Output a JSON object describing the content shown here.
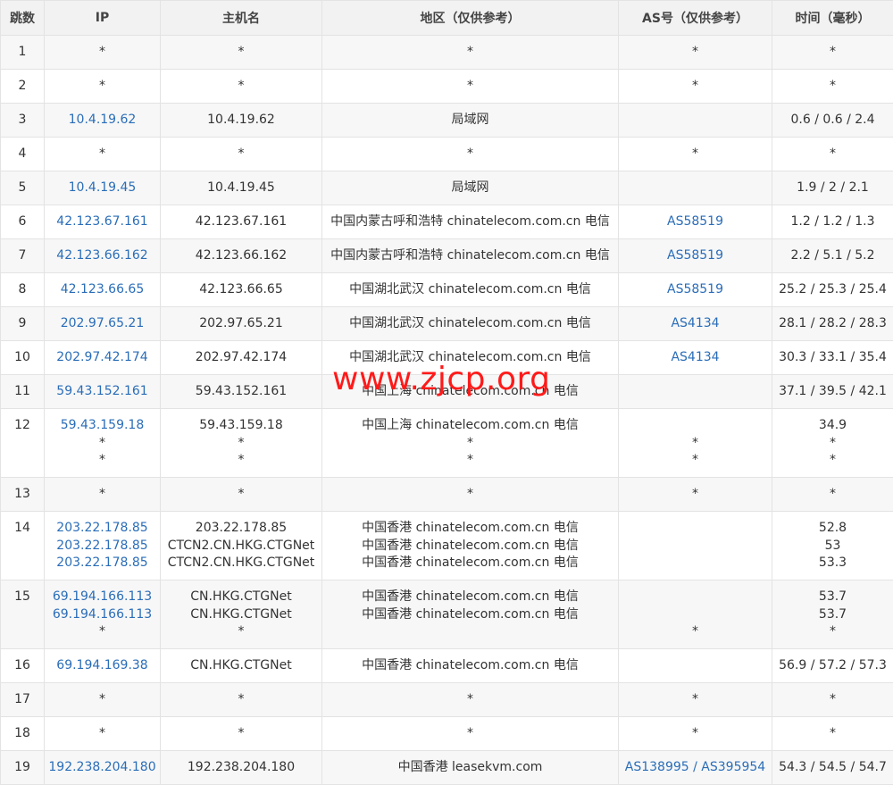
{
  "columns": [
    "跳数",
    "IP",
    "主机名",
    "地区（仅供参考）",
    "AS号（仅供参考）",
    "时间（毫秒）"
  ],
  "rows": [
    {
      "hop": "1",
      "ips": [
        "*"
      ],
      "hosts": [
        "*"
      ],
      "regions": [
        "*"
      ],
      "as": [
        "*"
      ],
      "times": [
        "*"
      ]
    },
    {
      "hop": "2",
      "ips": [
        "*"
      ],
      "hosts": [
        "*"
      ],
      "regions": [
        "*"
      ],
      "as": [
        "*"
      ],
      "times": [
        "*"
      ]
    },
    {
      "hop": "3",
      "ips": [
        "10.4.19.62"
      ],
      "hosts": [
        "10.4.19.62"
      ],
      "regions": [
        "局域网"
      ],
      "as": [
        ""
      ],
      "times": [
        "0.6 / 0.6 / 2.4"
      ]
    },
    {
      "hop": "4",
      "ips": [
        "*"
      ],
      "hosts": [
        "*"
      ],
      "regions": [
        "*"
      ],
      "as": [
        "*"
      ],
      "times": [
        "*"
      ]
    },
    {
      "hop": "5",
      "ips": [
        "10.4.19.45"
      ],
      "hosts": [
        "10.4.19.45"
      ],
      "regions": [
        "局域网"
      ],
      "as": [
        ""
      ],
      "times": [
        "1.9 / 2 / 2.1"
      ]
    },
    {
      "hop": "6",
      "ips": [
        "42.123.67.161"
      ],
      "hosts": [
        "42.123.67.161"
      ],
      "regions": [
        "中国内蒙古呼和浩特 chinatelecom.com.cn 电信"
      ],
      "as": [
        "AS58519"
      ],
      "times": [
        "1.2 / 1.2 / 1.3"
      ]
    },
    {
      "hop": "7",
      "ips": [
        "42.123.66.162"
      ],
      "hosts": [
        "42.123.66.162"
      ],
      "regions": [
        "中国内蒙古呼和浩特 chinatelecom.com.cn 电信"
      ],
      "as": [
        "AS58519"
      ],
      "times": [
        "2.2 / 5.1 / 5.2"
      ]
    },
    {
      "hop": "8",
      "ips": [
        "42.123.66.65"
      ],
      "hosts": [
        "42.123.66.65"
      ],
      "regions": [
        "中国湖北武汉 chinatelecom.com.cn 电信"
      ],
      "as": [
        "AS58519"
      ],
      "times": [
        "25.2 / 25.3 / 25.4"
      ]
    },
    {
      "hop": "9",
      "ips": [
        "202.97.65.21"
      ],
      "hosts": [
        "202.97.65.21"
      ],
      "regions": [
        "中国湖北武汉 chinatelecom.com.cn 电信"
      ],
      "as": [
        "AS4134"
      ],
      "times": [
        "28.1 / 28.2 / 28.3"
      ]
    },
    {
      "hop": "10",
      "ips": [
        "202.97.42.174"
      ],
      "hosts": [
        "202.97.42.174"
      ],
      "regions": [
        "中国湖北武汉 chinatelecom.com.cn 电信"
      ],
      "as": [
        "AS4134"
      ],
      "times": [
        "30.3 / 33.1 / 35.4"
      ]
    },
    {
      "hop": "11",
      "ips": [
        "59.43.152.161"
      ],
      "hosts": [
        "59.43.152.161"
      ],
      "regions": [
        "中国上海 chinatelecom.com.cn 电信"
      ],
      "as": [
        ""
      ],
      "times": [
        "37.1 / 39.5 / 42.1"
      ]
    },
    {
      "hop": "12",
      "ips": [
        "59.43.159.18",
        "*",
        "*"
      ],
      "hosts": [
        "59.43.159.18",
        "*",
        "*"
      ],
      "regions": [
        "中国上海 chinatelecom.com.cn 电信",
        "*",
        "*"
      ],
      "as": [
        "",
        "*",
        "*"
      ],
      "times": [
        "34.9",
        "*",
        "*"
      ]
    },
    {
      "hop": "13",
      "ips": [
        "*"
      ],
      "hosts": [
        "*"
      ],
      "regions": [
        "*"
      ],
      "as": [
        "*"
      ],
      "times": [
        "*"
      ]
    },
    {
      "hop": "14",
      "ips": [
        "203.22.178.85",
        "203.22.178.85",
        "203.22.178.85"
      ],
      "hosts": [
        "203.22.178.85",
        "CTCN2.CN.HKG.CTGNet",
        "CTCN2.CN.HKG.CTGNet"
      ],
      "regions": [
        "中国香港 chinatelecom.com.cn 电信",
        "中国香港 chinatelecom.com.cn 电信",
        "中国香港 chinatelecom.com.cn 电信"
      ],
      "as": [
        "",
        "",
        ""
      ],
      "times": [
        "52.8",
        "53",
        "53.3"
      ]
    },
    {
      "hop": "15",
      "ips": [
        "69.194.166.113",
        "69.194.166.113",
        "*"
      ],
      "hosts": [
        "CN.HKG.CTGNet",
        "CN.HKG.CTGNet",
        "*"
      ],
      "regions": [
        "中国香港 chinatelecom.com.cn 电信",
        "中国香港 chinatelecom.com.cn 电信",
        ""
      ],
      "as": [
        "",
        "",
        "*"
      ],
      "times": [
        "53.7",
        "53.7",
        "*"
      ]
    },
    {
      "hop": "16",
      "ips": [
        "69.194.169.38"
      ],
      "hosts": [
        "CN.HKG.CTGNet"
      ],
      "regions": [
        "中国香港 chinatelecom.com.cn 电信"
      ],
      "as": [
        ""
      ],
      "times": [
        "56.9 / 57.2 / 57.3"
      ]
    },
    {
      "hop": "17",
      "ips": [
        "*"
      ],
      "hosts": [
        "*"
      ],
      "regions": [
        "*"
      ],
      "as": [
        "*"
      ],
      "times": [
        "*"
      ]
    },
    {
      "hop": "18",
      "ips": [
        "*"
      ],
      "hosts": [
        "*"
      ],
      "regions": [
        "*"
      ],
      "as": [
        "*"
      ],
      "times": [
        "*"
      ]
    },
    {
      "hop": "19",
      "ips": [
        "192.238.204.180"
      ],
      "hosts": [
        "192.238.204.180"
      ],
      "regions": [
        "中国香港 leasekvm.com"
      ],
      "as": [
        "AS138995 / AS395954"
      ],
      "times": [
        "54.3 / 54.5 / 54.7"
      ]
    }
  ],
  "watermark": "www.zjcp.org",
  "colors": {
    "link": "#2a6db8",
    "header_bg": "#f2f2f2",
    "stripe_bg": "#f7f7f7",
    "border": "#e3e3e3",
    "watermark": "#ff1a1a"
  }
}
